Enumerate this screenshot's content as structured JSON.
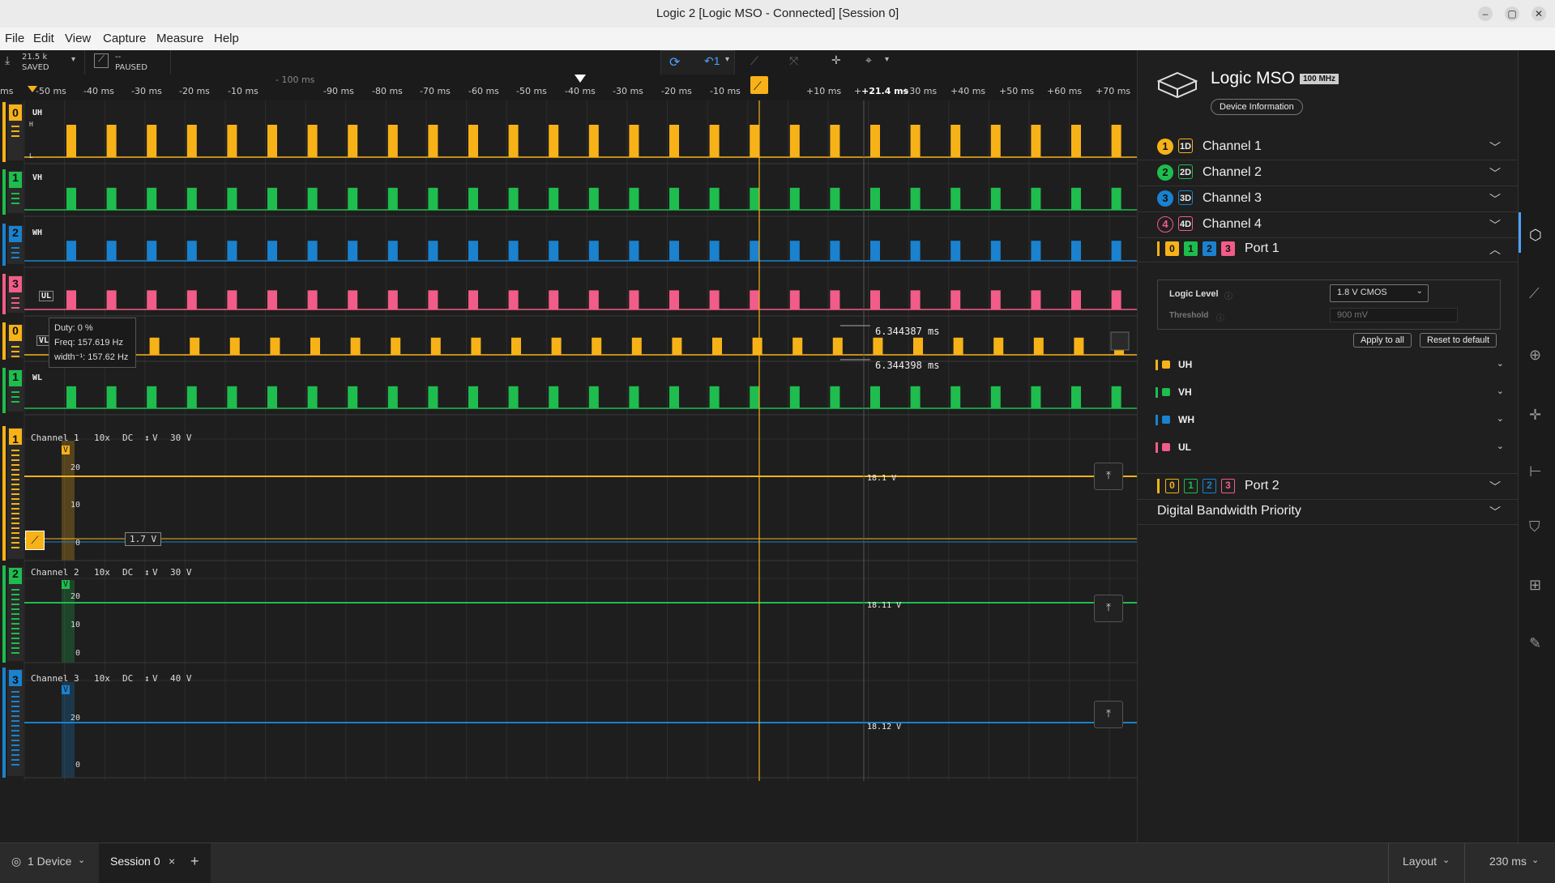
{
  "window": {
    "title": "Logic 2 [Logic MSO - Connected] [Session 0]"
  },
  "menu": [
    "File",
    "Edit",
    "View",
    "Capture",
    "Measure",
    "Help"
  ],
  "toolbar": {
    "samples": "21.5 k",
    "saved": "SAVED",
    "trigger_state": "--",
    "paused": "PAUSED"
  },
  "ruler": {
    "ticks": [
      "ms",
      "-50 ms",
      "-40 ms",
      "-30 ms",
      "-20 ms",
      "-10 ms",
      "-90 ms",
      "-80 ms",
      "-70 ms",
      "-60 ms",
      "-50 ms",
      "-40 ms",
      "-30 ms",
      "-20 ms",
      "-10 ms",
      "+10 ms",
      "+30 ms",
      "+40 ms",
      "+50 ms",
      "+60 ms",
      "+70 ms"
    ],
    "offset_label": "- 100 ms",
    "cursor_label": "+21.4 ms",
    "plus": "+"
  },
  "digital_rows": [
    {
      "index": "0",
      "name": "UH",
      "color": "#f7b218"
    },
    {
      "index": "1",
      "name": "VH",
      "color": "#1ebd4e"
    },
    {
      "index": "2",
      "name": "WH",
      "color": "#1a82cf"
    },
    {
      "index": "3",
      "name": "UL",
      "color": "#f25c88"
    },
    {
      "index": "0",
      "name": "VL",
      "color": "#f7b218"
    },
    {
      "index": "1",
      "name": "WL",
      "color": "#1ebd4e"
    }
  ],
  "row_hl": {
    "h": "H",
    "l": "L"
  },
  "tooltip": {
    "duty": "Duty: 0 %",
    "freq": "Freq: 157.619 Hz",
    "width": "width⁻¹: 157.62 Hz"
  },
  "measure": {
    "top": "6.344387 ms",
    "bottom": "6.344398 ms"
  },
  "analog": [
    {
      "index": "1",
      "name": "Channel 1",
      "probe": "10x",
      "coupling": "DC",
      "unit": "V",
      "range": "30 V",
      "color": "#f7b218",
      "scale": [
        "20",
        "10",
        "0"
      ],
      "value": "18.1 V",
      "trigger_level": "1.7 V",
      "unit_tag": "V"
    },
    {
      "index": "2",
      "name": "Channel 2",
      "probe": "10x",
      "coupling": "DC",
      "unit": "V",
      "range": "30 V",
      "color": "#1ebd4e",
      "scale": [
        "20",
        "10",
        "0"
      ],
      "value": "18.11 V",
      "unit_tag": "V"
    },
    {
      "index": "3",
      "name": "Channel 3",
      "probe": "10x",
      "coupling": "DC",
      "unit": "V",
      "range": "40 V",
      "color": "#1a82cf",
      "scale": [
        "20",
        "0"
      ],
      "value": "18.12 V",
      "unit_tag": "V"
    }
  ],
  "device": {
    "name": "Logic MSO",
    "rate": "100 MHz",
    "info_button": "Device Information"
  },
  "channels": [
    {
      "num": "1",
      "badge": "1D",
      "label": "Channel 1",
      "color": "#f7b218",
      "filled": true
    },
    {
      "num": "2",
      "badge": "2D",
      "label": "Channel 2",
      "color": "#1ebd4e",
      "filled": true
    },
    {
      "num": "3",
      "badge": "3D",
      "label": "Channel 3",
      "color": "#1a82cf",
      "filled": true
    },
    {
      "num": "4",
      "badge": "4D",
      "label": "Channel 4",
      "color": "#f25c88",
      "filled": false
    }
  ],
  "port1": {
    "label": "Port 1",
    "logic_level_label": "Logic Level",
    "logic_level_value": "1.8 V CMOS",
    "threshold_label": "Threshold",
    "threshold_placeholder": "900 mV",
    "apply_all": "Apply to all",
    "reset_default": "Reset to default",
    "signals": [
      {
        "name": "UH",
        "color": "#f7b218"
      },
      {
        "name": "VH",
        "color": "#1ebd4e"
      },
      {
        "name": "WH",
        "color": "#1a82cf"
      },
      {
        "name": "UL",
        "color": "#f25c88"
      }
    ]
  },
  "port_bits": [
    "0",
    "1",
    "2",
    "3"
  ],
  "port2": {
    "label": "Port 2"
  },
  "bandwidth": {
    "label": "Digital Bandwidth Priority"
  },
  "status": {
    "device": "1 Device",
    "session_tab": "Session 0",
    "close": "×",
    "add": "+",
    "layout": "Layout",
    "timescale": "230 ms"
  }
}
